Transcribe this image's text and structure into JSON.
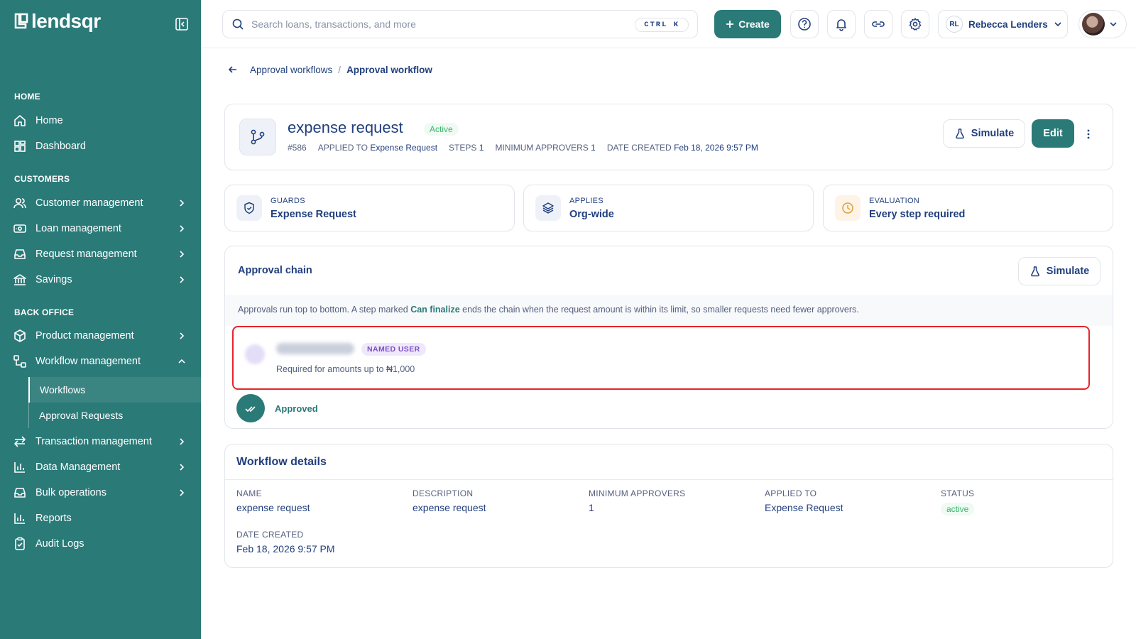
{
  "brand": {
    "name": "lendsqr"
  },
  "sidebar": {
    "sections": [
      {
        "title": "HOME",
        "items": [
          {
            "label": "Home"
          },
          {
            "label": "Dashboard"
          }
        ]
      },
      {
        "title": "CUSTOMERS",
        "items": [
          {
            "label": "Customer management"
          },
          {
            "label": "Loan management"
          },
          {
            "label": "Request management"
          },
          {
            "label": "Savings"
          }
        ]
      },
      {
        "title": "BACK OFFICE",
        "items": [
          {
            "label": "Product management"
          },
          {
            "label": "Workflow management"
          },
          {
            "label": "Transaction management"
          },
          {
            "label": "Data Management"
          },
          {
            "label": "Bulk operations"
          },
          {
            "label": "Reports"
          },
          {
            "label": "Audit Logs"
          }
        ]
      }
    ],
    "workflow_sub": [
      {
        "label": "Workflows",
        "active": true
      },
      {
        "label": "Approval Requests"
      }
    ]
  },
  "topbar": {
    "search_placeholder": "Search loans, transactions, and more",
    "shortcut": "CTRL K",
    "create_label": "Create",
    "user_initials": "RL",
    "user_name": "Rebecca Lenders"
  },
  "breadcrumb": {
    "parent": "Approval workflows",
    "separator": "/",
    "current": "Approval workflow"
  },
  "workflow": {
    "name": "expense request",
    "status_badge": "Active",
    "id": "#586",
    "applied_to_label": "APPLIED TO",
    "applied_to": "Expense Request",
    "steps_label": "STEPS",
    "steps": "1",
    "min_approvers_label": "MINIMUM APPROVERS",
    "min_approvers": "1",
    "date_created_label": "DATE CREATED",
    "date_created": "Feb 18, 2026 9:57 PM",
    "simulate_label": "Simulate",
    "edit_label": "Edit"
  },
  "info_cards": [
    {
      "label": "GUARDS",
      "value": "Expense Request",
      "icon": "shield-check-icon",
      "color": "#eef2f8"
    },
    {
      "label": "APPLIES",
      "value": "Org-wide",
      "icon": "layers-icon",
      "color": "#eef2f8"
    },
    {
      "label": "EVALUATION",
      "value": "Every step required",
      "icon": "clock-icon",
      "color": "#fdf3e6"
    }
  ],
  "chain": {
    "title": "Approval chain",
    "simulate_label": "Simulate",
    "note_before": "Approvals run top to bottom. A step marked ",
    "note_strong": "Can finalize",
    "note_after": " ends the chain when the request amount is within its limit, so smaller requests need fewer approvers.",
    "step_badge": "NAMED USER",
    "step_sub": "Required for amounts up to ₦1,000",
    "approved_label": "Approved"
  },
  "details": {
    "title": "Workflow details",
    "fields": [
      {
        "label": "NAME",
        "value": "expense request"
      },
      {
        "label": "DESCRIPTION",
        "value": "expense request"
      },
      {
        "label": "MINIMUM APPROVERS",
        "value": "1"
      },
      {
        "label": "APPLIED TO",
        "value": "Expense Request"
      },
      {
        "label": "STATUS",
        "value": "active"
      },
      {
        "label": "DATE CREATED",
        "value": "Feb 18, 2026 9:57 PM"
      }
    ]
  },
  "colors": {
    "brand": "#2a7a78",
    "text": "#213f7d",
    "active_green": "#39b56a",
    "highlight": "#e5252a"
  }
}
